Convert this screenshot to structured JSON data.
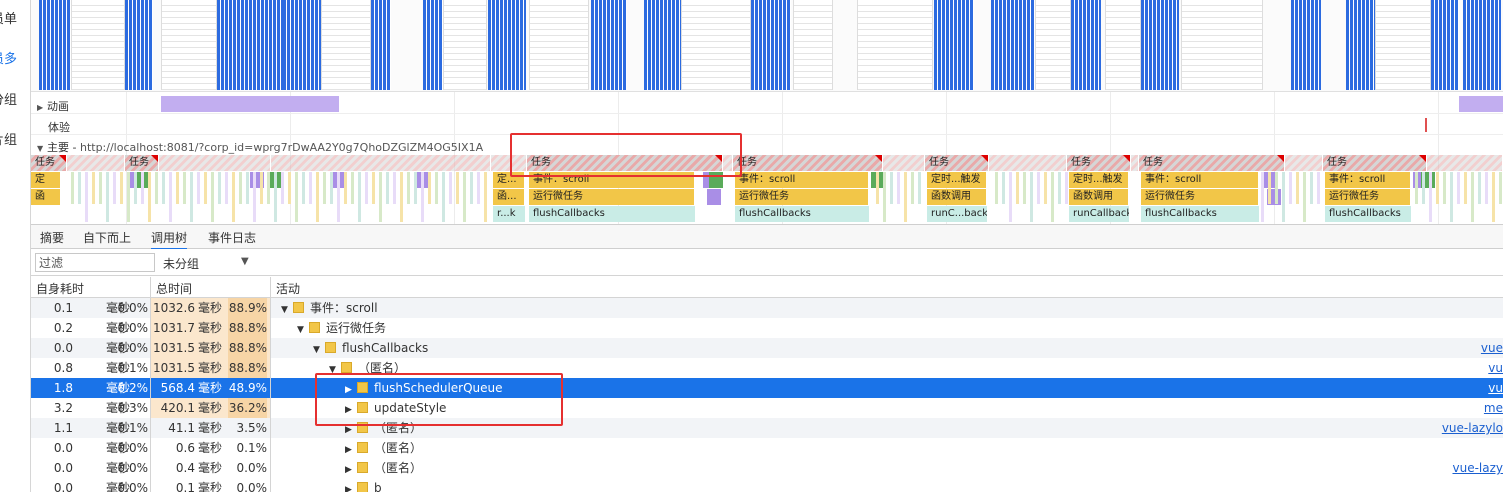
{
  "page_sidebar": {
    "labels": [
      "员单",
      "员多",
      "分组",
      "片组"
    ]
  },
  "timeline": {
    "tracks": {
      "animation": "动画",
      "experience": "体验",
      "main_prefix": "主要",
      "main_url": "http://localhost:8081/?corp_id=wprg7rDwAA2Y0g7QhoDZGlZM4OG5IX1A"
    },
    "task_label": "任务",
    "blocks": {
      "timer": "定时...触发",
      "event_scroll": "事件：scroll",
      "microtask": "运行微任务",
      "func_call": "函数调用",
      "flush_callbacks": "flushCallbacks",
      "run_callback": "runCallback",
      "run_callback_short": "runC...back",
      "ding": "定",
      "han": "函",
      "ding_dots": "定...",
      "han_dots": "函...",
      "r_dots_k": "r...k",
      "event_scroll_cut": "事件：sc",
      "dot": ".."
    }
  },
  "tabs": [
    "摘要",
    "自下而上",
    "调用树",
    "事件日志"
  ],
  "active_tab": "调用树",
  "filter": {
    "placeholder": "过滤",
    "group_value": "未分组"
  },
  "calltree": {
    "columns": {
      "self_time": "自身耗时",
      "total_time": "总时间",
      "activity": "活动"
    },
    "unit": "毫秒",
    "rows": [
      {
        "self": "0.1",
        "self_pct": "0.0%",
        "total": "1032.6",
        "total_pct": "88.9%",
        "expanded": true,
        "depth": 0,
        "name": "事件：scroll",
        "source": ""
      },
      {
        "self": "0.2",
        "self_pct": "0.0%",
        "total": "1031.7",
        "total_pct": "88.8%",
        "expanded": true,
        "depth": 1,
        "name": "运行微任务",
        "source": ""
      },
      {
        "self": "0.0",
        "self_pct": "0.0%",
        "total": "1031.5",
        "total_pct": "88.8%",
        "expanded": true,
        "depth": 2,
        "name": "flushCallbacks",
        "source": "vue"
      },
      {
        "self": "0.8",
        "self_pct": "0.1%",
        "total": "1031.5",
        "total_pct": "88.8%",
        "expanded": true,
        "depth": 3,
        "name": "（匿名）",
        "source": "vu"
      },
      {
        "self": "1.8",
        "self_pct": "0.2%",
        "total": "568.4",
        "total_pct": "48.9%",
        "expanded": false,
        "depth": 4,
        "name": "flushSchedulerQueue",
        "source": "vu",
        "selected": true
      },
      {
        "self": "3.2",
        "self_pct": "0.3%",
        "total": "420.1",
        "total_pct": "36.2%",
        "expanded": false,
        "depth": 4,
        "name": "updateStyle",
        "source": "me"
      },
      {
        "self": "1.1",
        "self_pct": "0.1%",
        "total": "41.1",
        "total_pct": "3.5%",
        "expanded": false,
        "depth": 4,
        "name": "（匿名）",
        "source": "vue-lazylo"
      },
      {
        "self": "0.0",
        "self_pct": "0.0%",
        "total": "0.6",
        "total_pct": "0.1%",
        "expanded": false,
        "depth": 4,
        "name": "（匿名）",
        "source": ""
      },
      {
        "self": "0.0",
        "self_pct": "0.0%",
        "total": "0.4",
        "total_pct": "0.0%",
        "expanded": false,
        "depth": 4,
        "name": "（匿名）",
        "source": "vue-lazy"
      },
      {
        "self": "0.0",
        "self_pct": "0.0%",
        "total": "0.1",
        "total_pct": "0.0%",
        "expanded": false,
        "depth": 4,
        "name": "b",
        "source": ""
      }
    ]
  },
  "colors": {
    "accent_blue": "#1a73e8",
    "event_yellow": "#f2c648",
    "flush_teal": "#c9ece6",
    "annotation_red": "#e53030"
  }
}
